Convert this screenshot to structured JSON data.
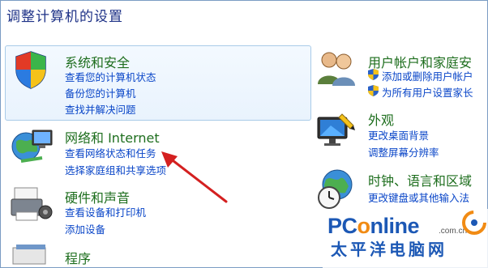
{
  "page": {
    "title": "调整计算机的设置"
  },
  "left_column": [
    {
      "id": "system-security",
      "heading": "系统和安全",
      "icon": "shield-icon",
      "links": [
        "查看您的计算机状态",
        "备份您的计算机",
        "查找并解决问题"
      ]
    },
    {
      "id": "network-internet",
      "heading": "网络和 Internet",
      "icon": "network-globe-icon",
      "links": [
        "查看网络状态和任务",
        "选择家庭组和共享选项"
      ]
    },
    {
      "id": "hardware-sound",
      "heading": "硬件和声音",
      "icon": "printer-icon",
      "links": [
        "查看设备和打印机",
        "添加设备"
      ]
    },
    {
      "id": "programs",
      "heading": "程序",
      "icon": "programs-icon",
      "links": []
    }
  ],
  "right_column": [
    {
      "id": "user-accounts",
      "heading": "用户帐户和家庭安",
      "icon": "users-icon",
      "links": [
        "添加或删除用户帐户",
        "为所有用户设置家长"
      ]
    },
    {
      "id": "appearance",
      "heading": "外观",
      "icon": "monitor-icon",
      "links": [
        "更改桌面背景",
        "调整屏幕分辨率"
      ]
    },
    {
      "id": "clock-language-region",
      "heading": "时钟、语言和区域",
      "icon": "globe-clock-icon",
      "links": [
        "更改键盘或其他输入法"
      ]
    }
  ],
  "watermark": {
    "logo_pc": "PC",
    "logo_o": "o",
    "logo_rest": "nline",
    "domain": ".com.cn",
    "cn_text": "太平洋电脑网"
  },
  "colors": {
    "heading": "#1e6e1e",
    "link": "#0a46c8",
    "title": "#1e3287",
    "arrow": "#d42020",
    "highlight_border": "#a9cbe8"
  }
}
